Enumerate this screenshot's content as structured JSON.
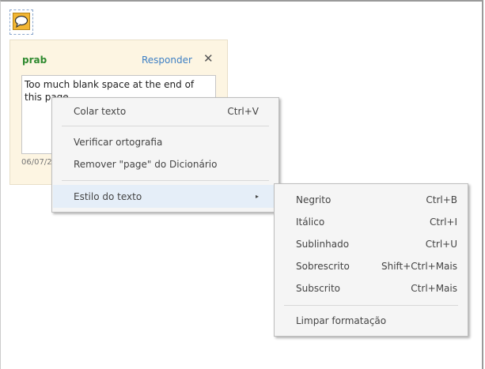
{
  "comment": {
    "author": "prab",
    "reply_label": "Responder",
    "close_label": "✕",
    "text": "Too much blank space at the end of this page.",
    "date": "06/07/2"
  },
  "context_menu": {
    "items": [
      {
        "label": "Colar texto",
        "shortcut": "Ctrl+V"
      },
      {
        "label": "Verificar ortografia"
      },
      {
        "label": "Remover \"page\" do Dicionário"
      },
      {
        "label": "Estilo do texto",
        "submenu_arrow": "▸"
      }
    ]
  },
  "submenu": {
    "items": [
      {
        "label": "Negrito",
        "shortcut": "Ctrl+B"
      },
      {
        "label": "Itálico",
        "shortcut": "Ctrl+I"
      },
      {
        "label": "Sublinhado",
        "shortcut": "Ctrl+U"
      },
      {
        "label": "Sobrescrito",
        "shortcut": "Shift+Ctrl+Mais"
      },
      {
        "label": "Subscrito",
        "shortcut": "Ctrl+Mais"
      },
      {
        "label": "Limpar formatação"
      }
    ]
  }
}
